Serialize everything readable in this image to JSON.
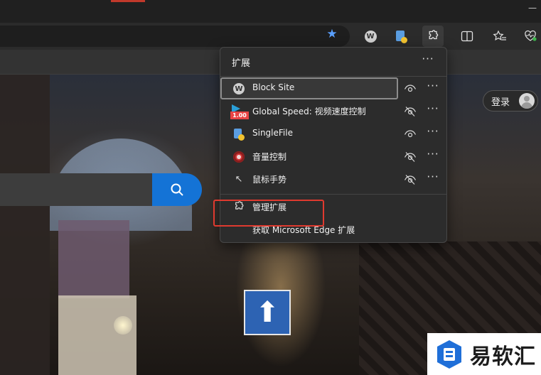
{
  "browser": {
    "address_bar_placeholder": "",
    "login_label": "登录"
  },
  "extensions_menu": {
    "title": "扩展",
    "items": [
      {
        "name": "Block Site",
        "icon": "w-circle-icon",
        "visible_in_toolbar": true
      },
      {
        "name": "Global Speed: 视频速度控制",
        "icon": "global-speed-icon",
        "badge": "1.00",
        "visible_in_toolbar": false
      },
      {
        "name": "SingleFile",
        "icon": "singlefile-icon",
        "visible_in_toolbar": true
      },
      {
        "name": "音量控制",
        "icon": "volume-control-icon",
        "visible_in_toolbar": false
      },
      {
        "name": "鼠标手势",
        "icon": "mouse-gesture-icon",
        "visible_in_toolbar": false
      }
    ],
    "manage_label": "管理扩展",
    "get_label": "获取 Microsoft Edge 扩展"
  },
  "toolbar_ext_badge": "W",
  "watermark": {
    "text": "易软汇"
  },
  "colors": {
    "accent_blue": "#1473d6",
    "highlight_red": "#e03a2f",
    "menu_bg": "#2c2c2c"
  }
}
